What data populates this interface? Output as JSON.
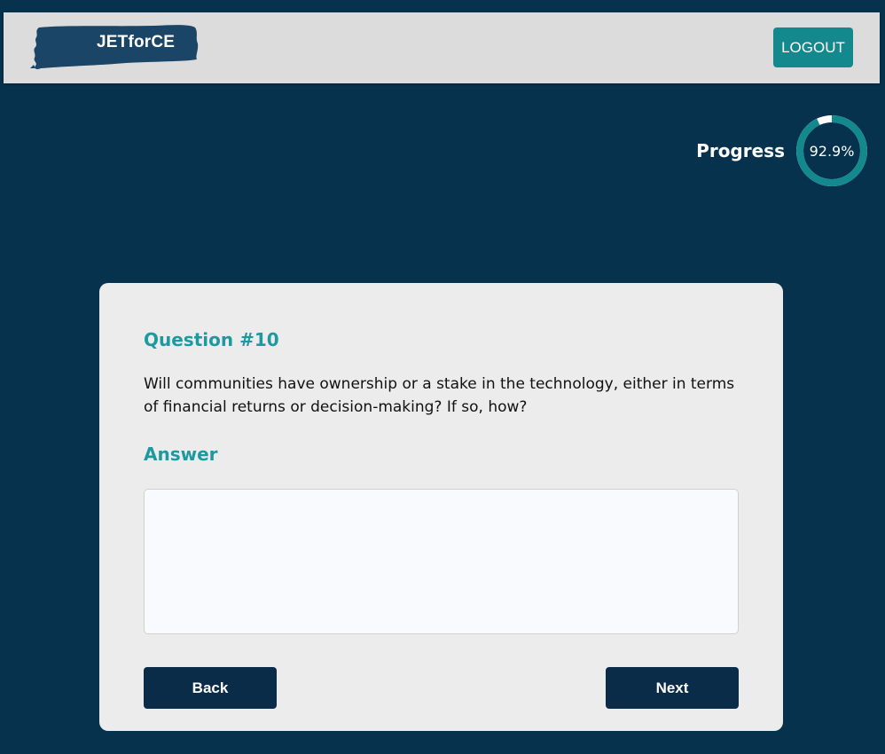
{
  "header": {
    "logo_text": "JETforCE",
    "logout_label": "LOGOUT"
  },
  "progress": {
    "label": "Progress",
    "value_text": "92.9%",
    "fraction": 0.929
  },
  "question": {
    "title": "Question #10",
    "text": "Will communities have ownership or a stake in the technology, either in terms of financial returns or decision-making? If so, how?"
  },
  "answer": {
    "label": "Answer",
    "value": ""
  },
  "nav": {
    "back_label": "Back",
    "next_label": "Next"
  },
  "colors": {
    "background": "#06324d",
    "accent": "#13888d",
    "heading": "#1d9aa0",
    "button_dark": "#0b2c48",
    "logo_brush": "#1b4566"
  }
}
